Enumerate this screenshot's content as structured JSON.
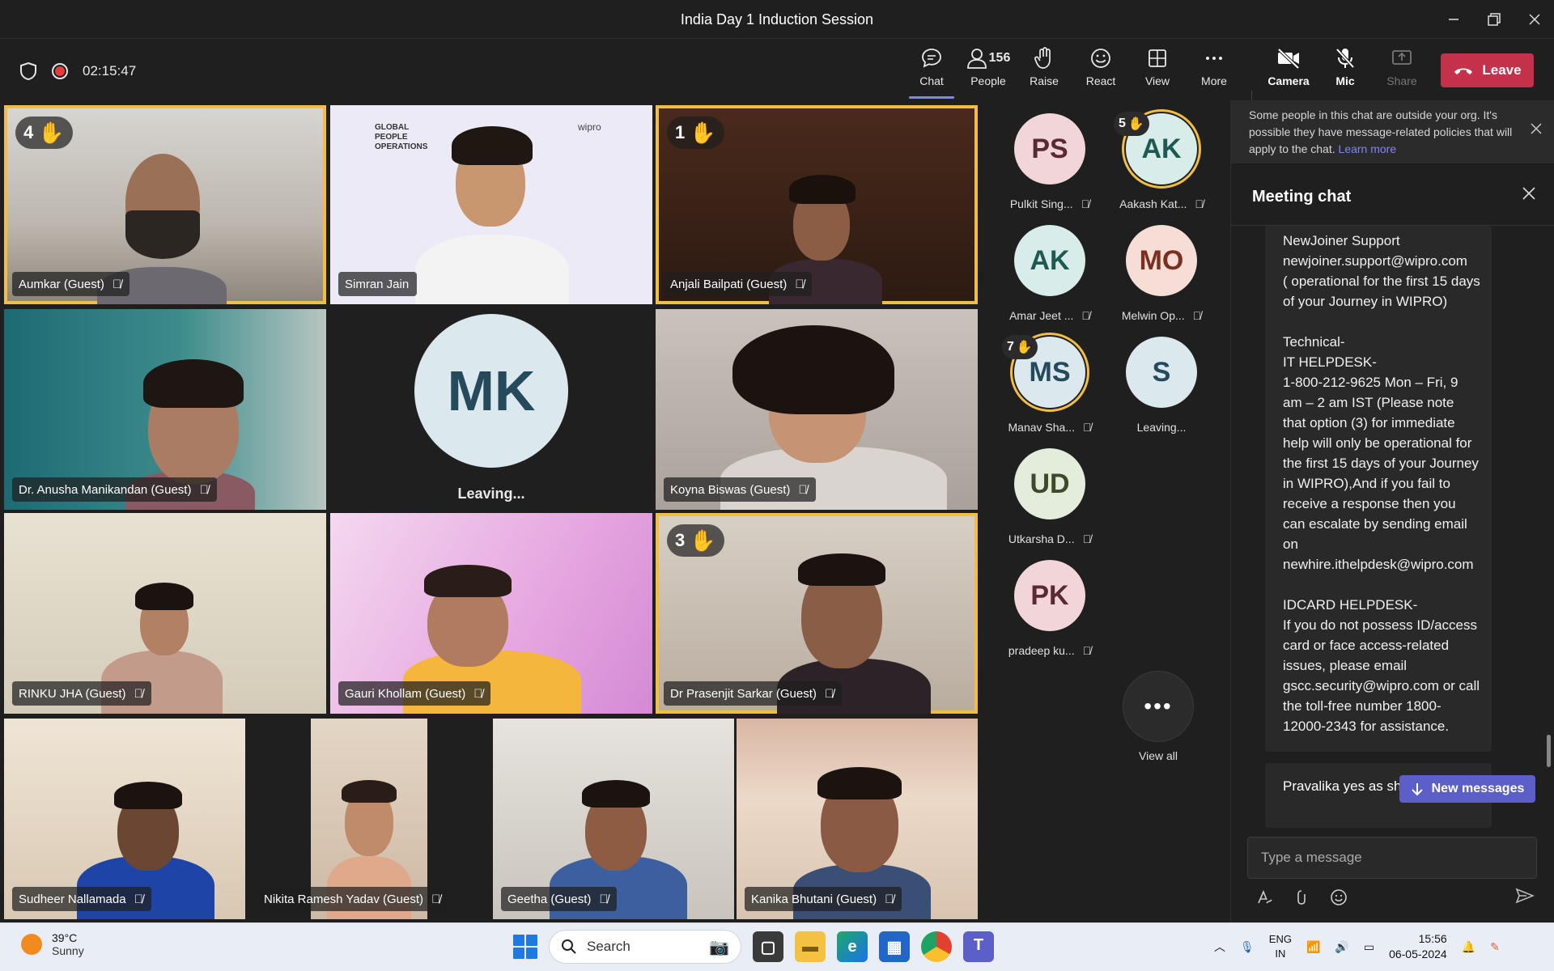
{
  "window": {
    "title": "India Day 1 Induction Session"
  },
  "toolbar": {
    "timer": "02:15:47",
    "chat_label": "Chat",
    "people_label": "People",
    "people_count": "156",
    "raise_label": "Raise",
    "react_label": "React",
    "view_label": "View",
    "more_label": "More",
    "camera_label": "Camera",
    "mic_label": "Mic",
    "share_label": "Share",
    "leave_label": "Leave"
  },
  "tiles": [
    {
      "name": "Aumkar (Guest)",
      "hand": "4"
    },
    {
      "name": "Simran Jain"
    },
    {
      "name": "Anjali Bailpati (Guest)",
      "hand": "1"
    },
    {
      "name": "Dr. Anusha Manikandan (Guest)"
    },
    {
      "initials": "MK",
      "status": "Leaving..."
    },
    {
      "name": "Koyna Biswas (Guest)"
    },
    {
      "name": "RINKU JHA (Guest)"
    },
    {
      "name": "Gauri Khollam (Guest)"
    },
    {
      "name": "Dr Prasenjit Sarkar (Guest)",
      "hand": "3"
    },
    {
      "name": "Sudheer Nallamada"
    },
    {
      "name": "Nikita Ramesh Yadav (Guest)"
    },
    {
      "name": "Geetha (Guest)"
    },
    {
      "name": "Kanika Bhutani (Guest)"
    }
  ],
  "slide": {
    "line1": "GLOBAL",
    "line2": "PEOPLE",
    "line3": "OPERATIONS",
    "brand": "wipro"
  },
  "participants": [
    {
      "initials": "PS",
      "name": "Pulkit Sing..."
    },
    {
      "initials": "AK",
      "name": "Aakash Kat...",
      "hand": "5"
    },
    {
      "initials": "AK",
      "name": "Amar Jeet ..."
    },
    {
      "initials": "MO",
      "name": "Melwin Op..."
    },
    {
      "initials": "MS",
      "name": "Manav Sha...",
      "hand": "7"
    },
    {
      "initials": "S",
      "name": "Leaving..."
    },
    {
      "initials": "UD",
      "name": "Utkarsha D..."
    },
    {
      "initials": "PK",
      "name": "pradeep ku..."
    }
  ],
  "view_all_label": "View all",
  "chat": {
    "notice": "Some people in this chat are outside your org. It's possible they have message-related policies that will apply to the chat.",
    "notice_link": "Learn more",
    "title": "Meeting chat",
    "message": "NewJoiner Support\nnewjoiner.support@wipro.com\n( operational for the first 15 days of your Journey in WIPRO)\n\nTechnical-\nIT HELPDESK-\n1-800-212-9625 Mon – Fri, 9 am – 2 am IST (Please note that option (3) for immediate help will only be operational for the first 15 days of your Journey in WIPRO),And if you fail to receive a response then you can escalate by sending email on\nnewhire.ithelpdesk@wipro.com\n\nIDCARD HELPDESK-\nIf you do not possess ID/access card or face access-related issues, please email gscc.security@wipro.com or call the toll-free number 1800-12000-2343 for assistance.",
    "message2": "Pravalika yes as she video",
    "new_messages": "New messages",
    "compose_placeholder": "Type a message"
  },
  "taskbar": {
    "temp": "39°C",
    "weather": "Sunny",
    "search": "Search",
    "lang1": "ENG",
    "lang2": "IN",
    "time": "15:56",
    "date": "06-05-2024"
  },
  "colors": {
    "accent": "#7f85f5",
    "leave": "#c4314b",
    "highlight": "#f2bd43",
    "button": "#5b5fc7"
  }
}
